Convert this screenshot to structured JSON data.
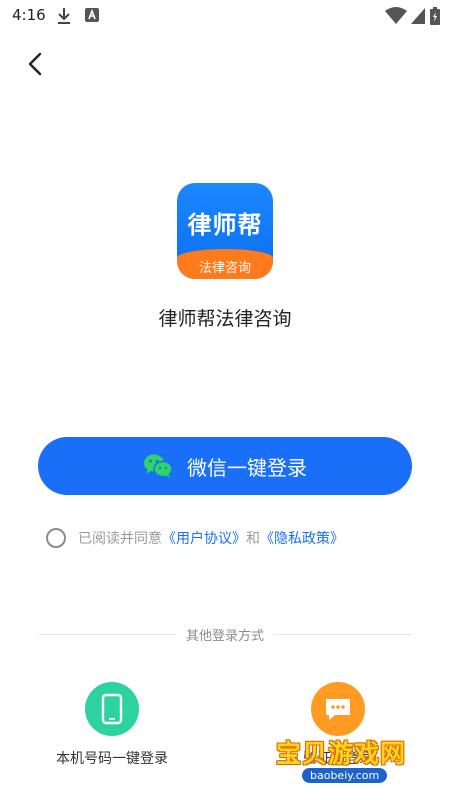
{
  "status_bar": {
    "time": "4:16"
  },
  "logo": {
    "title": "律师帮",
    "subtitle": "法律咨询"
  },
  "app_name": "律师帮法律咨询",
  "wechat_login": {
    "label": "微信一键登录"
  },
  "agreement": {
    "prefix": "已阅读并同意",
    "user_agreement": "《用户协议》",
    "and": "和",
    "privacy_policy": "《隐私政策》"
  },
  "other_login": {
    "divider": "其他登录方式",
    "phone_label": "本机号码一键登录",
    "sms_label": "验证码登录"
  },
  "watermark": {
    "text": "宝贝游戏网",
    "url": "baobeiy.com"
  },
  "colors": {
    "primary": "#1a6ff9",
    "phone_green": "#2cd3a0",
    "sms_orange": "#ff9b22"
  }
}
